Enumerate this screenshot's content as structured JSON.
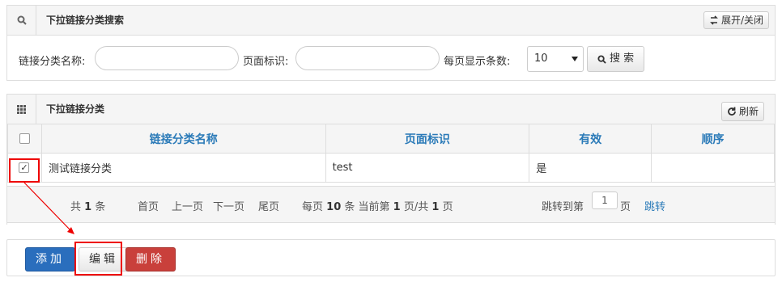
{
  "search_panel": {
    "title": "下拉链接分类搜索",
    "toggle_label": "展开/关闭",
    "name_label": "链接分类名称:",
    "name_value": "",
    "page_id_label": "页面标识:",
    "page_id_value": "",
    "per_page_label": "每页显示条数:",
    "per_page_value": "10",
    "search_label": "搜 索"
  },
  "list_panel": {
    "title": "下拉链接分类",
    "refresh_label": "刷新",
    "columns": [
      "链接分类名称",
      "页面标识",
      "有效",
      "顺序"
    ],
    "rows": [
      {
        "checked": true,
        "name": "测试链接分类",
        "page_id": "test",
        "valid": "是",
        "order": ""
      }
    ]
  },
  "pager": {
    "total_prefix": "共",
    "total": "1",
    "total_suffix": "条",
    "first": "首页",
    "prev": "上一页",
    "next": "下一页",
    "last": "尾页",
    "per_prefix": "每页",
    "per": "10",
    "per_suffix": "条 当前第",
    "current": "1",
    "page_sep": "页/共",
    "pages": "1",
    "pages_suffix": "页",
    "jump_label": "跳转到第",
    "jump_value": "1",
    "jump_unit": "页",
    "jump_link": "跳转"
  },
  "actions": {
    "add": "添加",
    "edit": "编辑",
    "delete": "删除"
  },
  "colors": {
    "link_blue": "#2a7ab8",
    "add_blue": "#2a6ebd",
    "delete_red": "#c9403b",
    "annotation_red": "#e00000"
  },
  "icons": {
    "search_panel": "search-icon",
    "list_panel": "grid-icon",
    "toggle": "toggle-icon",
    "refresh": "refresh-icon",
    "search_button": "search-icon"
  }
}
